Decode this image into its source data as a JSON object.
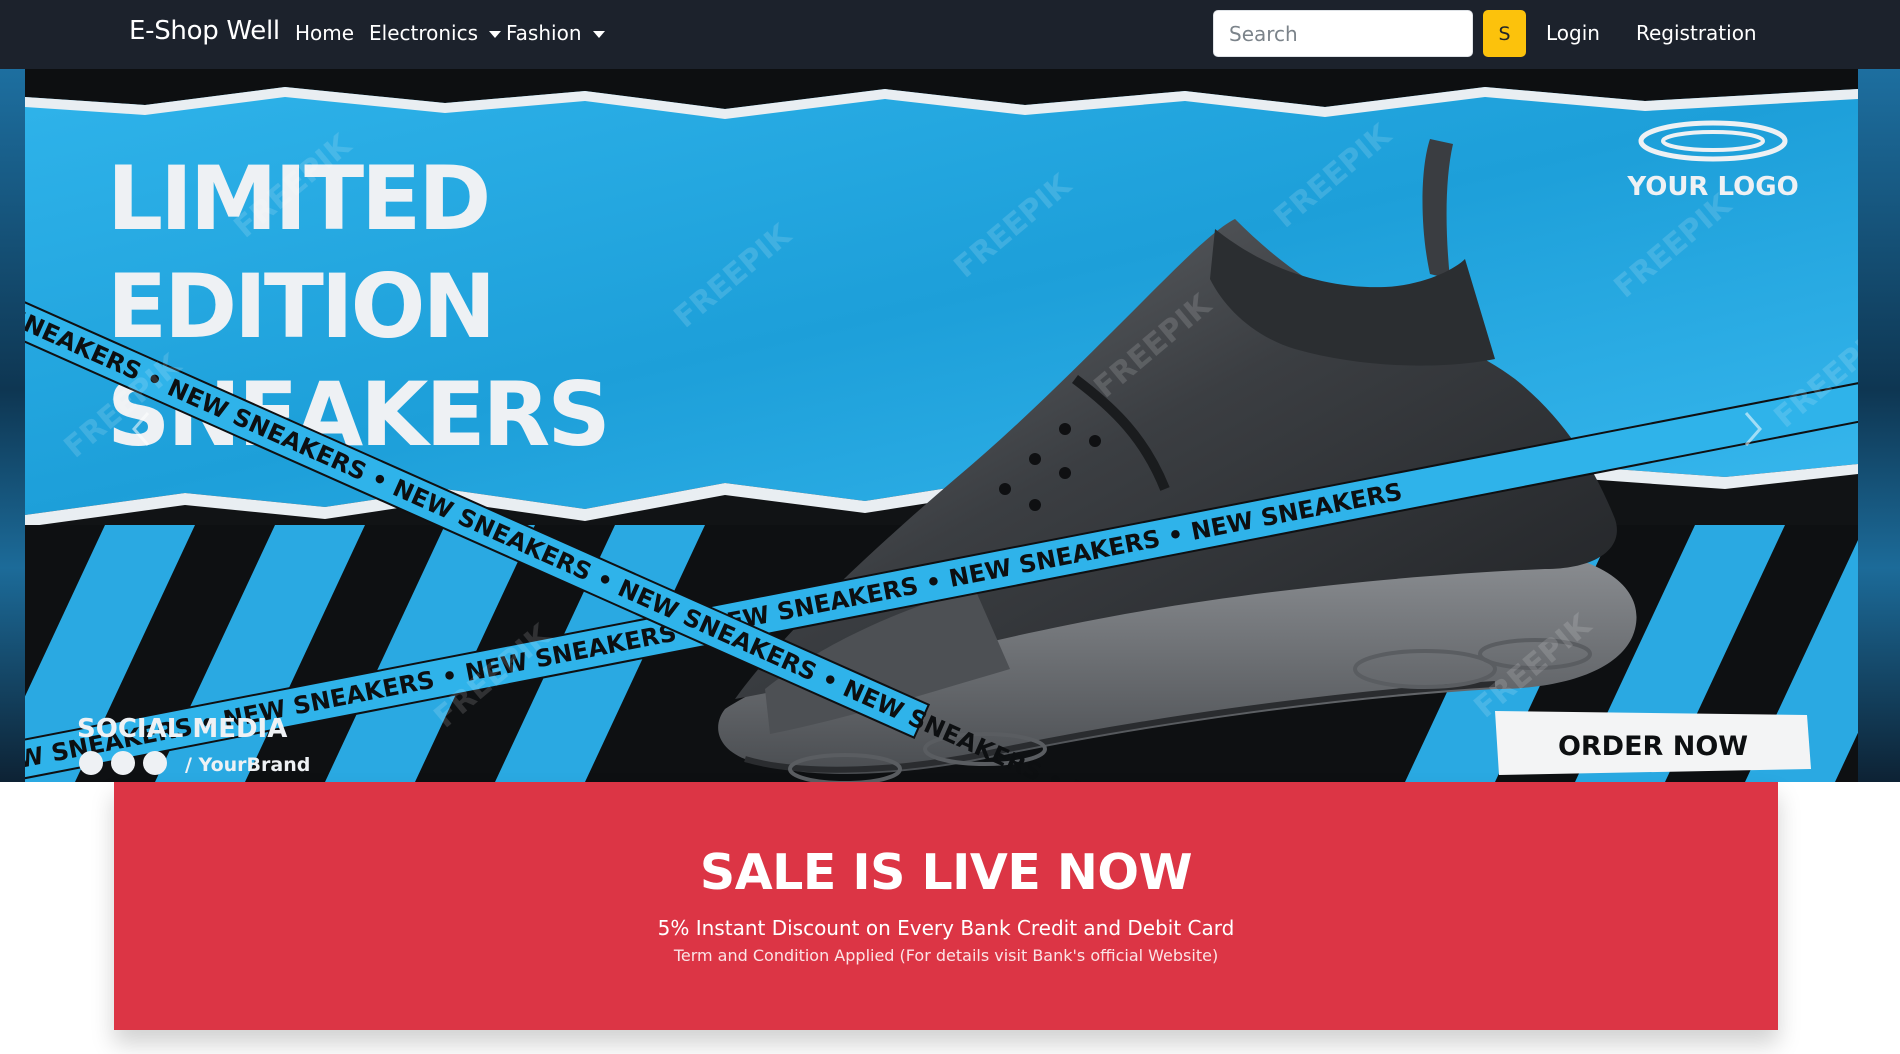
{
  "navbar": {
    "brand": "E-Shop Well",
    "links": [
      {
        "label": "Home"
      },
      {
        "label": "Electronics"
      },
      {
        "label": "Fashion"
      }
    ],
    "search_placeholder": "Search",
    "search_button": "S",
    "login": "Login",
    "registration": "Registration"
  },
  "banner": {
    "headline": [
      "LIMITED",
      "EDITION",
      "SNEAKERS"
    ],
    "logo_text": "YOUR LOGO",
    "tape_text": "NEW SNEAKERS • NEW SNEAKERS • NEW SNEAKERS • NEW SNEAKERS • NEW SNEAKERS • NEW SNEAKERS",
    "social_title": "SOCIAL MEDIA",
    "social_handle": "/ YourBrand",
    "order_button": "ORDER NOW",
    "watermark": "FREEPIK"
  },
  "sale": {
    "title": "SALE IS LIVE NOW",
    "subtitle": "5% Instant Discount on Every Bank Credit and Debit Card",
    "note": "Term and Condition Applied (For details visit Bank's official Website)"
  },
  "colors": {
    "navbar_bg": "#1c222c",
    "search_button_bg": "#fcc20c",
    "sale_bg": "#dc3545",
    "banner_blue": "#1fa6e0"
  }
}
